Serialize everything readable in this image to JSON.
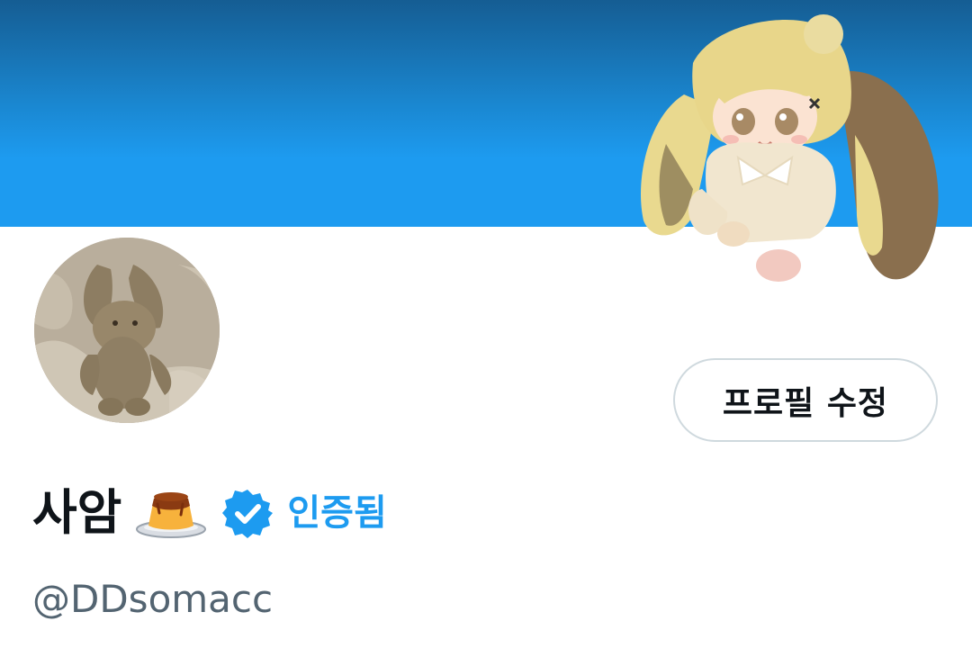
{
  "profile": {
    "display_name": "사암",
    "name_emoji": "pudding-icon",
    "verified_label": "인증됨",
    "handle": "@DDsomacc",
    "edit_button_label": "프로필 수정"
  },
  "colors": {
    "accent": "#1d9bf0",
    "banner_top": "#155d93",
    "text_primary": "#0f1419",
    "text_secondary": "#536471",
    "button_border": "#cfd9de"
  }
}
